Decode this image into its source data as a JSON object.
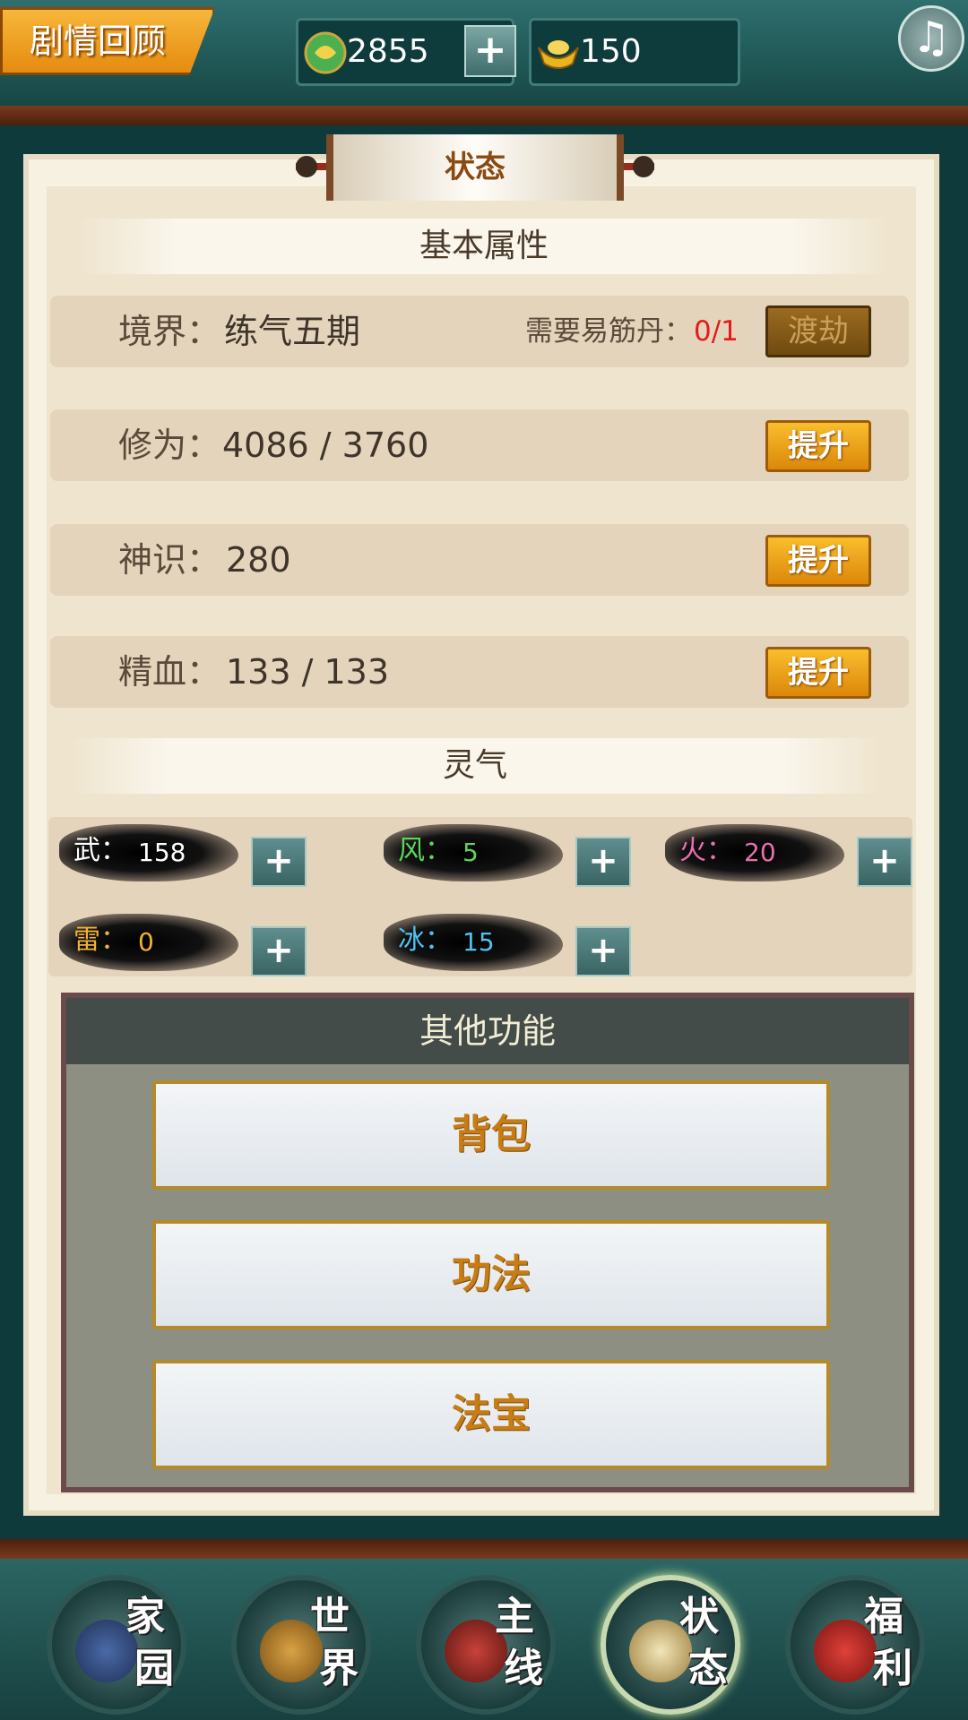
{
  "topbar": {
    "story_button": "剧情回顾",
    "jade_amount": "2855",
    "gold_amount": "150",
    "plus_label": "+",
    "music_icon": "music-note-icon"
  },
  "panel": {
    "title": "状态",
    "basic_header": "基本属性",
    "realm": {
      "label": "境界：",
      "value": "练气五期",
      "need_label": "需要易筋丹：",
      "need_value": "0/1",
      "button": "渡劫"
    },
    "cultivation": {
      "label": "修为：",
      "value": "4086 / 3760",
      "button": "提升"
    },
    "divine_sense": {
      "label": "神识：",
      "value": "280",
      "button": "提升"
    },
    "essence_blood": {
      "label": "精血：",
      "value": "133 / 133",
      "button": "提升"
    },
    "spirit_header": "灵气",
    "spirits": [
      {
        "name": "武：",
        "value": "158",
        "color": "#ffffff"
      },
      {
        "name": "风：",
        "value": "5",
        "color": "#5cd65c"
      },
      {
        "name": "火：",
        "value": "20",
        "color": "#e86fb0"
      },
      {
        "name": "雷：",
        "value": "0",
        "color": "#f2b233"
      },
      {
        "name": "冰：",
        "value": "15",
        "color": "#4fc3f0"
      }
    ],
    "spirit_plus": "+"
  },
  "functions": {
    "header": "其他功能",
    "buttons": [
      "背包",
      "功法",
      "法宝"
    ]
  },
  "nav": [
    {
      "t1": "家",
      "t2": "园",
      "icon": "home-icon",
      "active": false
    },
    {
      "t1": "世",
      "t2": "界",
      "icon": "world-icon",
      "active": false
    },
    {
      "t1": "主",
      "t2": "线",
      "icon": "main-quest-icon",
      "active": false
    },
    {
      "t1": "状",
      "t2": "态",
      "icon": "status-icon",
      "active": true
    },
    {
      "t1": "福",
      "t2": "利",
      "icon": "welfare-icon",
      "active": false
    }
  ],
  "colors": {
    "accent_orange": "#f0a020",
    "need_red": "#e51a1a",
    "panel_bg": "#efe5cf"
  }
}
